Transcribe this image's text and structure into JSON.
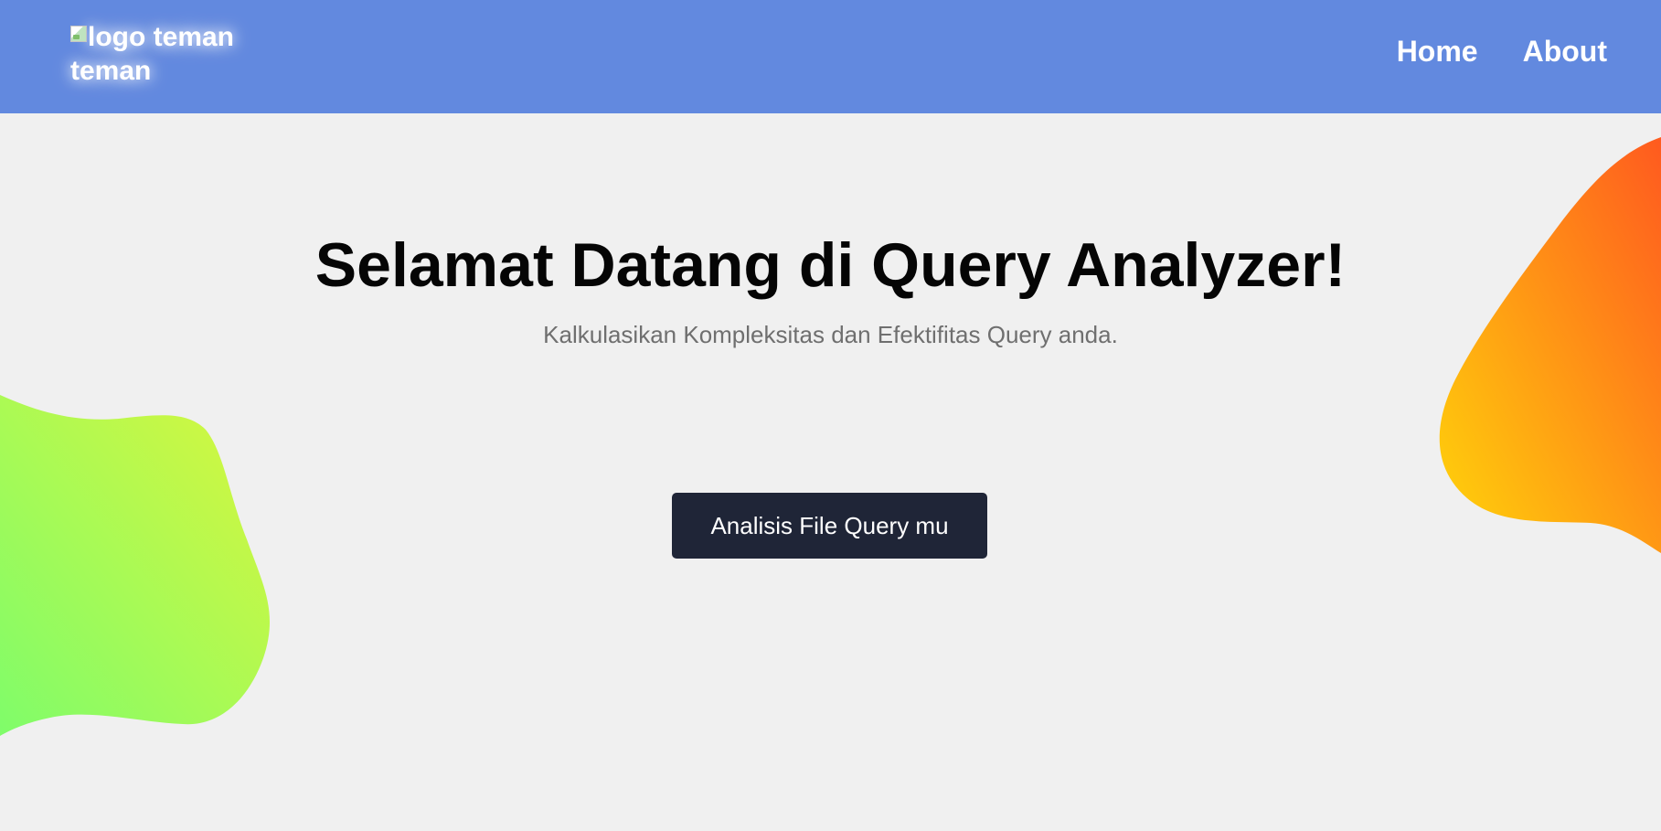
{
  "header": {
    "logo_alt_text": "logo teman teman",
    "nav": [
      {
        "label": "Home"
      },
      {
        "label": "About"
      }
    ],
    "background_color": "#6289df"
  },
  "hero": {
    "title": "Selamat Datang di Query Analyzer!",
    "subtitle": "Kalkulasikan Kompleksitas dan Efektifitas Query anda.",
    "cta_label": "Analisis File Query mu",
    "cta_color": "#1f2537"
  },
  "decorations": {
    "left_blob_colors": [
      "#d9f73d",
      "#7ffc6a"
    ],
    "right_blob_colors": [
      "#ff5a1f",
      "#ffd60a"
    ]
  },
  "page_background": "#f0f0f0"
}
